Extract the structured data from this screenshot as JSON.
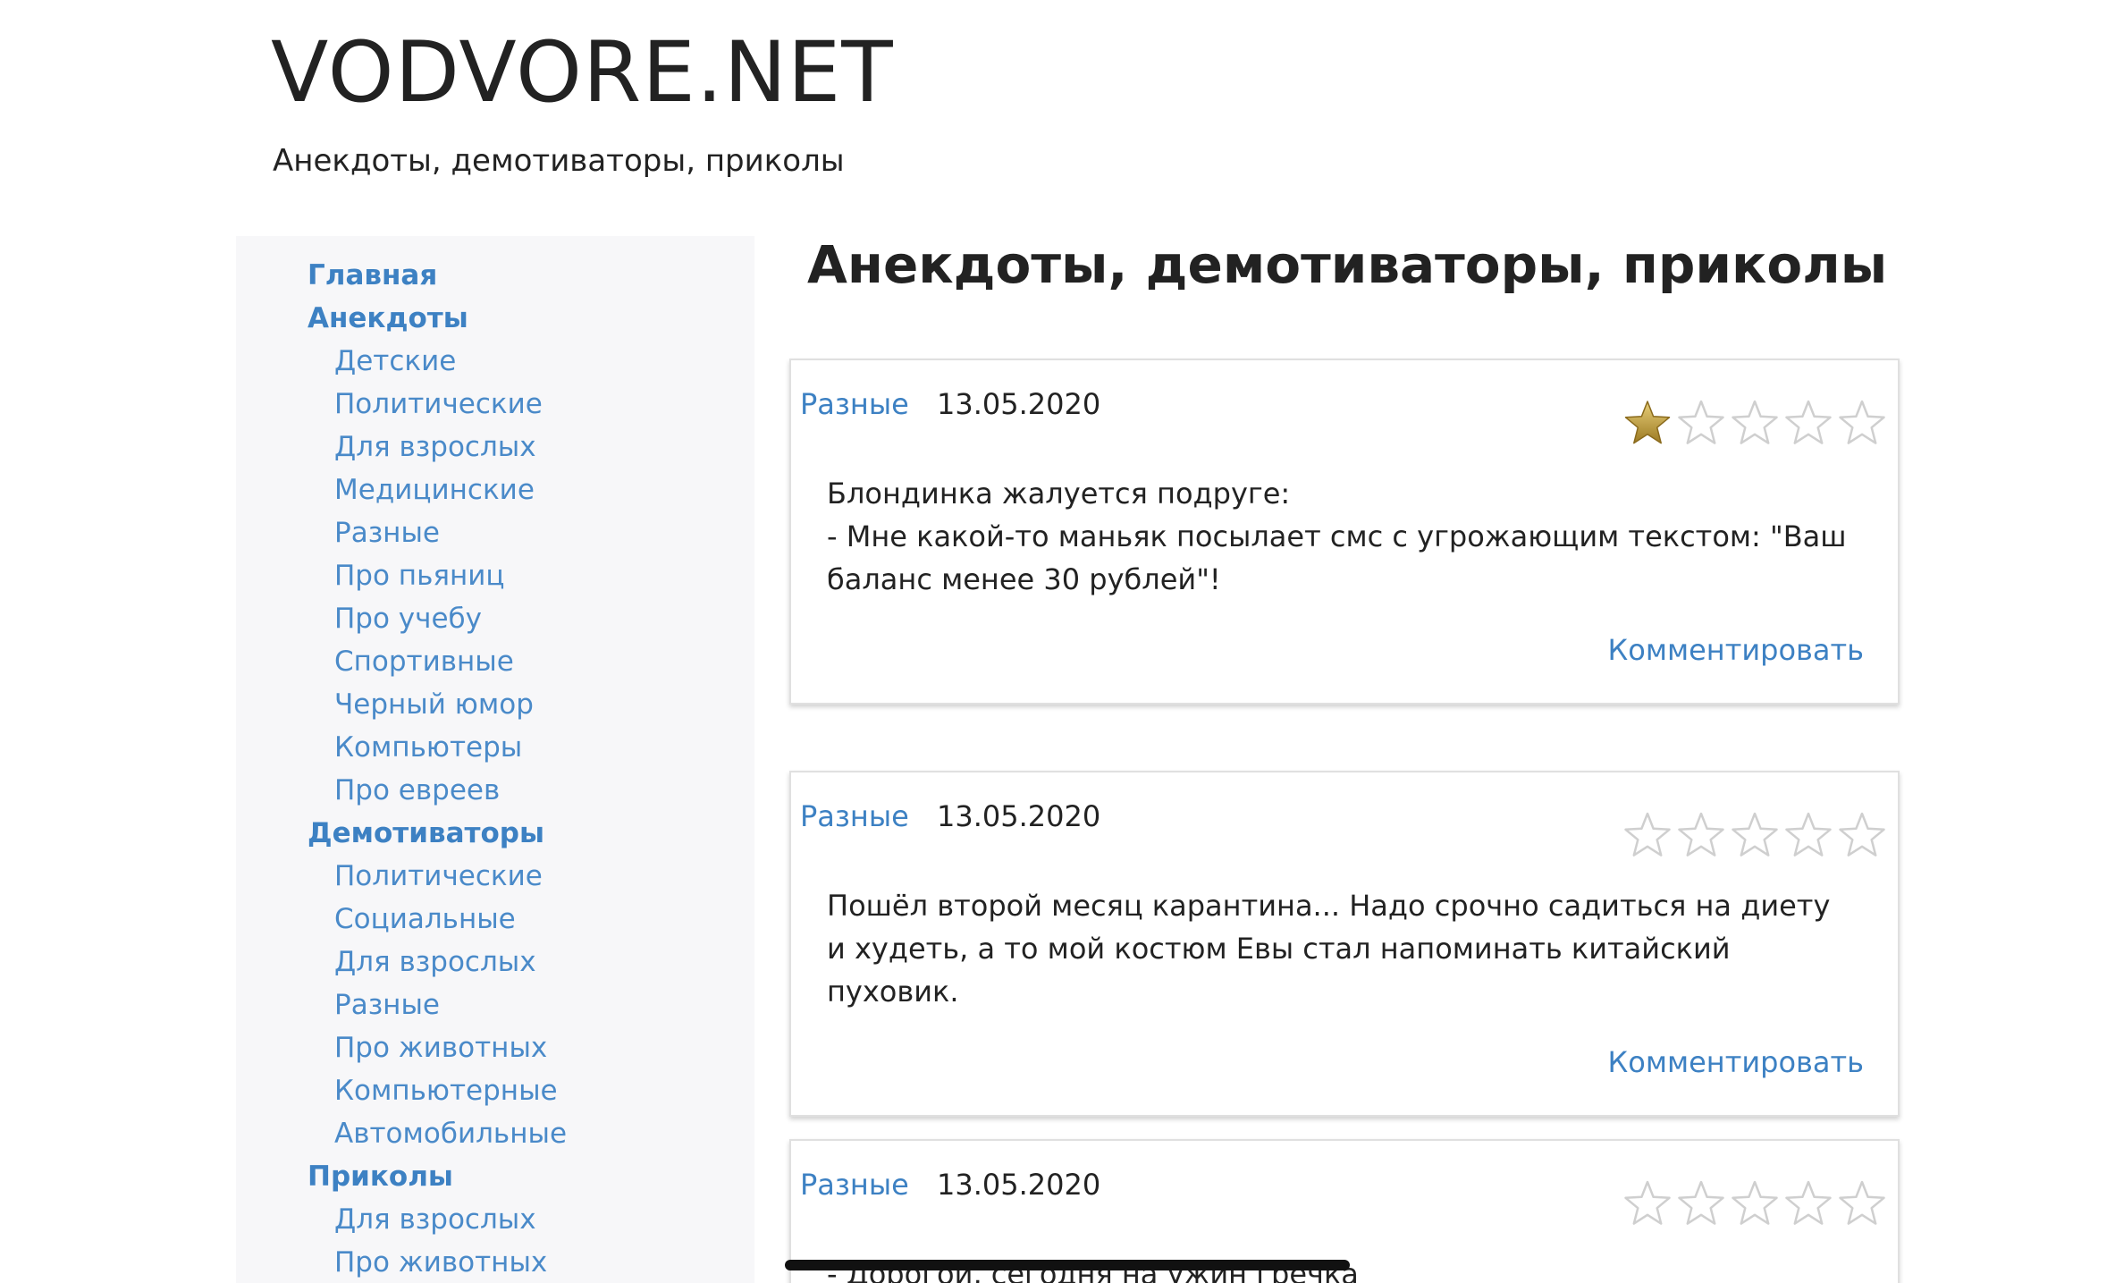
{
  "site": {
    "title": "VODVORE.NET",
    "subtitle": "Анекдоты, демотиваторы, приколы"
  },
  "sidebar": {
    "items": [
      {
        "label": "Главная",
        "level": 0
      },
      {
        "label": "Анекдоты",
        "level": 0
      },
      {
        "label": "Детские",
        "level": 1
      },
      {
        "label": "Политические",
        "level": 1
      },
      {
        "label": "Для взрослых",
        "level": 1
      },
      {
        "label": "Медицинские",
        "level": 1
      },
      {
        "label": "Разные",
        "level": 1
      },
      {
        "label": "Про пьяниц",
        "level": 1
      },
      {
        "label": "Про учебу",
        "level": 1
      },
      {
        "label": "Спортивные",
        "level": 1
      },
      {
        "label": "Черный юмор",
        "level": 1
      },
      {
        "label": "Компьютеры",
        "level": 1
      },
      {
        "label": "Про евреев",
        "level": 1
      },
      {
        "label": "Демотиваторы",
        "level": 0
      },
      {
        "label": "Политические",
        "level": 1
      },
      {
        "label": "Социальные",
        "level": 1
      },
      {
        "label": "Для взрослых",
        "level": 1
      },
      {
        "label": "Разные",
        "level": 1
      },
      {
        "label": "Про животных",
        "level": 1
      },
      {
        "label": "Компьютерные",
        "level": 1
      },
      {
        "label": "Автомобильные",
        "level": 1
      },
      {
        "label": "Приколы",
        "level": 0
      },
      {
        "label": "Для взрослых",
        "level": 1
      },
      {
        "label": "Про животных",
        "level": 1
      }
    ]
  },
  "main": {
    "heading": "Анекдоты, демотиваторы, приколы"
  },
  "posts": [
    {
      "category": "Разные",
      "date": "13.05.2020",
      "rating": 1,
      "rating_max": 5,
      "lines": [
        "Блондинка жалуется подруге:",
        "- Мне какой-то маньяк посылает смс с угрожающим текстом: \"Ваш баланс менее 30 рублей\"!"
      ],
      "comment_label": "Комментировать"
    },
    {
      "category": "Разные",
      "date": "13.05.2020",
      "rating": 0,
      "rating_max": 5,
      "lines": [
        "Пошёл второй месяц карантина... Надо срочно садиться на диету и худеть, а то мой костюм Евы стал напоминать китайский пуховик."
      ],
      "comment_label": "Комментировать"
    },
    {
      "category": "Разные",
      "date": "13.05.2020",
      "rating": 0,
      "rating_max": 5,
      "lines": [
        "- Дорогой, сегодня на ужин гречка"
      ],
      "comment_label": ""
    }
  ],
  "colors": {
    "link": "#3d81c3",
    "sidebar_bg": "#f7f7f9",
    "star_filled": "#c9a43a",
    "star_empty_stroke": "#cfcfcf"
  },
  "icons": {
    "star_filled": "star-filled-icon",
    "star_empty": "star-empty-icon"
  }
}
